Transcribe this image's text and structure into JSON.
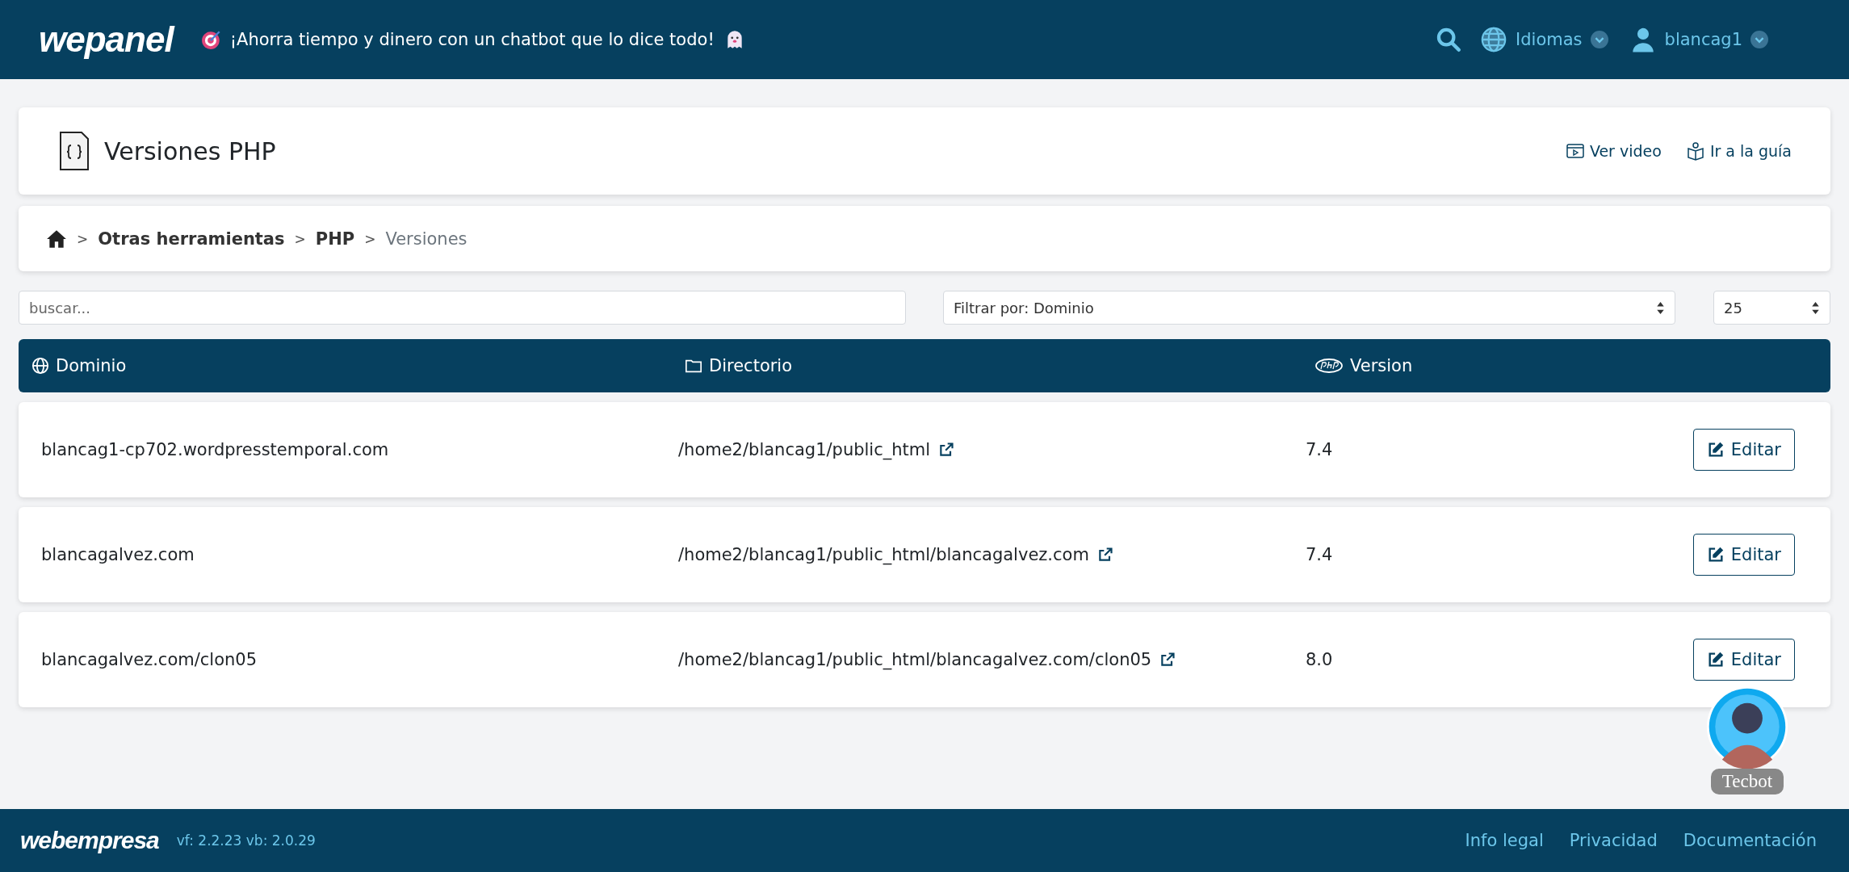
{
  "header": {
    "logo": "wepanel",
    "announcement": "¡Ahorra tiempo y dinero con un chatbot que lo dice todo!",
    "language_menu": "Idiomas",
    "user_menu": "blancag1"
  },
  "page_title": "Versiones PHP",
  "header_links": [
    {
      "label": "Ver video",
      "kind": "video"
    },
    {
      "label": "Ir a la guía",
      "kind": "guide"
    }
  ],
  "breadcrumb": [
    {
      "label": "Otras herramientas",
      "current": false
    },
    {
      "label": "PHP",
      "current": false
    },
    {
      "label": "Versiones",
      "current": true
    }
  ],
  "breadcrumb_separator": ">",
  "search": {
    "placeholder": "buscar..."
  },
  "filter": {
    "value": "Filtrar por: Dominio"
  },
  "page_size": {
    "value": "25"
  },
  "table": {
    "columns": [
      {
        "label": "Dominio",
        "kind": "globe"
      },
      {
        "label": "Directorio",
        "kind": "folder"
      },
      {
        "label": "Version",
        "kind": "php"
      }
    ],
    "rows": [
      {
        "domain": "blancag1-cp702.wordpresstemporal.com",
        "directory": "/home2/blancag1/public_html",
        "version": "7.4",
        "action": "Editar"
      },
      {
        "domain": "blancagalvez.com",
        "directory": "/home2/blancag1/public_html/blancagalvez.com",
        "version": "7.4",
        "action": "Editar"
      },
      {
        "domain": "blancagalvez.com/clon05",
        "directory": "/home2/blancag1/public_html/blancagalvez.com/clon05",
        "version": "8.0",
        "action": "Editar"
      }
    ]
  },
  "chatbot": {
    "label": "Tecbot"
  },
  "footer": {
    "logo": "webempresa",
    "version": "vf: 2.2.23 vb: 2.0.29",
    "links": [
      "Info legal",
      "Privacidad",
      "Documentación"
    ]
  }
}
